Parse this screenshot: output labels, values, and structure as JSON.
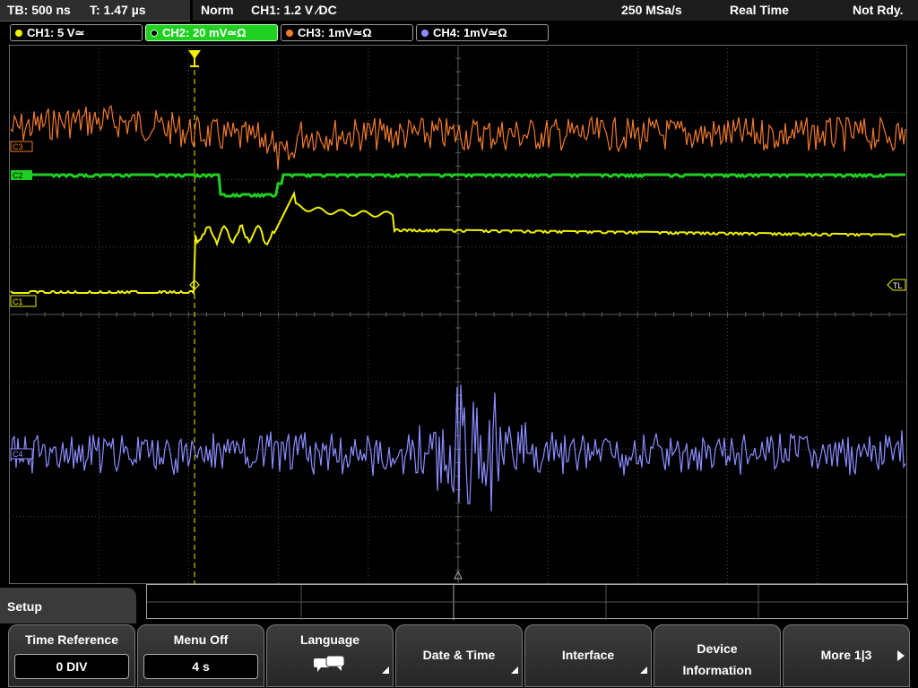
{
  "status": {
    "timebase": "TB: 500 ns",
    "trigger_time": "T: 1.47 µs",
    "trigger_mode": "Norm",
    "trigger_source": "CH1: 1.2 V ∕DC",
    "sample_rate": "250 MSa/s",
    "acq_mode": "Real Time",
    "state": "Not Rdy."
  },
  "channels": [
    {
      "label": "CH1: 5 V≃",
      "color": "#f0f000"
    },
    {
      "label": "CH2: 20 mV≃Ω",
      "color": "#20d020"
    },
    {
      "label": "CH3: 1mV≃Ω",
      "color": "#f07a2a"
    },
    {
      "label": "CH4: 1mV≃Ω",
      "color": "#8c8cff"
    }
  ],
  "markers": {
    "c3": "C3",
    "c2": "C2",
    "c1": "C1",
    "c4": "C4",
    "tl": "TL"
  },
  "menu": {
    "title": "Setup",
    "softkeys": [
      {
        "label": "Time Reference",
        "value": "0 DIV"
      },
      {
        "label": "Menu Off",
        "value": "4 s"
      },
      {
        "label": "Language"
      },
      {
        "label": "Date & Time"
      },
      {
        "label": "Interface"
      },
      {
        "label": "Device Information"
      },
      {
        "label": "More 1|3"
      }
    ]
  },
  "colors": {
    "ch1": "#f0f000",
    "ch2": "#20d020",
    "ch3": "#f07a2a",
    "ch4": "#8c8cff",
    "grid": "#4a4a4a"
  }
}
